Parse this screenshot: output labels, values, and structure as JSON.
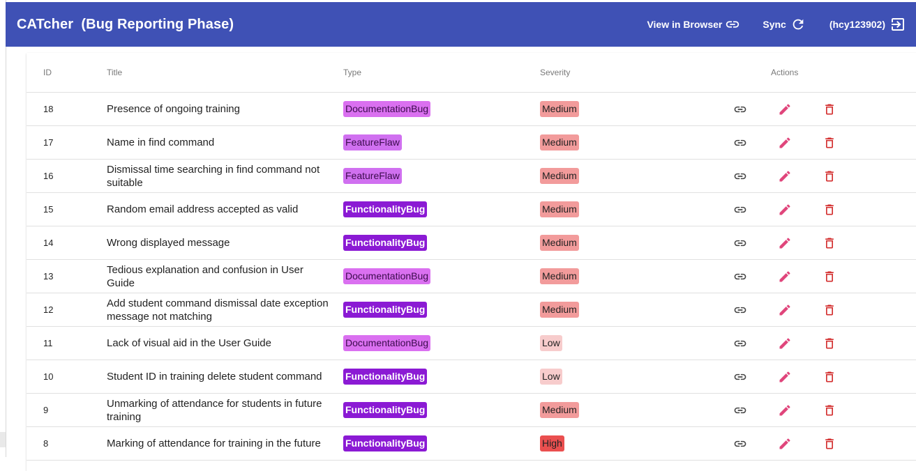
{
  "app": {
    "title": "CATcher  (Bug Reporting Phase)",
    "actions": {
      "view_in_browser": "View in Browser",
      "sync": "Sync",
      "user": "(hcy123902)"
    }
  },
  "table": {
    "headers": {
      "id": "ID",
      "title": "Title",
      "type": "Type",
      "severity": "Severity",
      "actions": "Actions"
    },
    "rows": [
      {
        "id": "18",
        "title": "Presence of ongoing training",
        "type": "DocumentationBug",
        "type_class": "documentationbug",
        "severity": "Medium",
        "sev_class": "sev-medium"
      },
      {
        "id": "17",
        "title": "Name in find command",
        "type": "FeatureFlaw",
        "type_class": "featureflaw",
        "severity": "Medium",
        "sev_class": "sev-medium"
      },
      {
        "id": "16",
        "title": "Dismissal time searching in find command not suitable",
        "type": "FeatureFlaw",
        "type_class": "featureflaw",
        "severity": "Medium",
        "sev_class": "sev-medium"
      },
      {
        "id": "15",
        "title": "Random email address accepted as valid",
        "type": "FunctionalityBug",
        "type_class": "functionalitybug",
        "severity": "Medium",
        "sev_class": "sev-medium"
      },
      {
        "id": "14",
        "title": "Wrong displayed message",
        "type": "FunctionalityBug",
        "type_class": "functionalitybug",
        "severity": "Medium",
        "sev_class": "sev-medium"
      },
      {
        "id": "13",
        "title": "Tedious explanation and confusion in User Guide",
        "type": "DocumentationBug",
        "type_class": "documentationbug",
        "severity": "Medium",
        "sev_class": "sev-medium"
      },
      {
        "id": "12",
        "title": "Add student command dismissal date exception message not matching",
        "type": "FunctionalityBug",
        "type_class": "functionalitybug",
        "severity": "Medium",
        "sev_class": "sev-medium"
      },
      {
        "id": "11",
        "title": "Lack of visual aid in the User Guide",
        "type": "DocumentationBug",
        "type_class": "documentationbug",
        "severity": "Low",
        "sev_class": "sev-low"
      },
      {
        "id": "10",
        "title": "Student ID in training delete student command",
        "type": "FunctionalityBug",
        "type_class": "functionalitybug",
        "severity": "Low",
        "sev_class": "sev-low"
      },
      {
        "id": "9",
        "title": "Unmarking of attendance for students in future training",
        "type": "FunctionalityBug",
        "type_class": "functionalitybug",
        "severity": "Medium",
        "sev_class": "sev-medium"
      },
      {
        "id": "8",
        "title": "Marking of attendance for training in the future",
        "type": "FunctionalityBug",
        "type_class": "functionalitybug",
        "severity": "High",
        "sev_class": "sev-high"
      }
    ]
  },
  "icons": {
    "view_in_browser": "link-icon",
    "sync": "refresh-icon",
    "logout": "logout-icon",
    "row_link": "link-icon",
    "row_edit": "pencil-icon",
    "row_delete": "trash-icon"
  },
  "colors": {
    "toolbar": "#3f51b5",
    "edit_icon": "#e0457b",
    "delete_icon": "#d32f2f"
  }
}
